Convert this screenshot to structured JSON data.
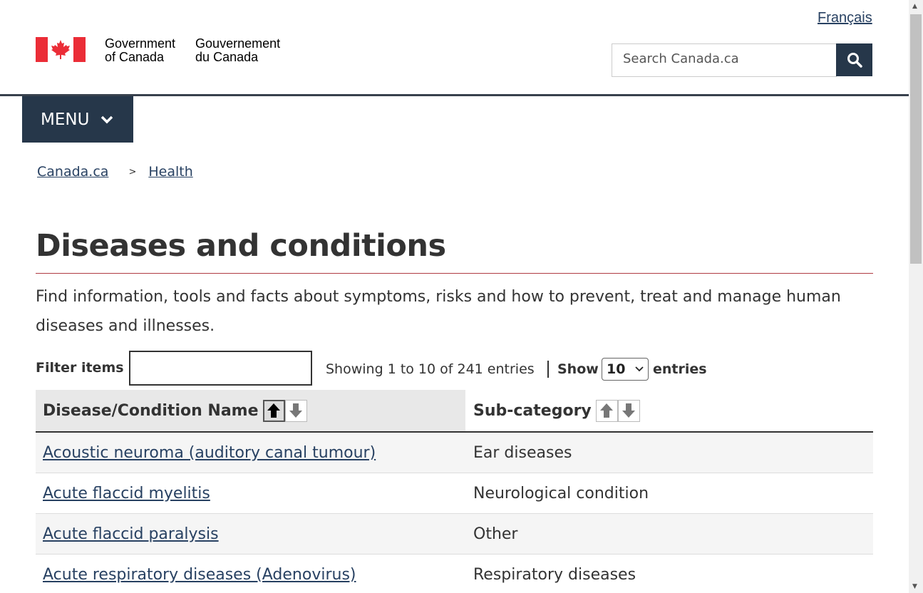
{
  "header": {
    "language_link": "Français",
    "logo_en": [
      "Government",
      "of Canada"
    ],
    "logo_fr": [
      "Gouvernement",
      "du Canada"
    ],
    "search_placeholder": "Search Canada.ca",
    "menu_label": "MENU",
    "flag_color": "#eb2d37",
    "nav_color": "#26374a"
  },
  "breadcrumb": {
    "items": [
      "Canada.ca",
      "Health"
    ],
    "separator": ">"
  },
  "main": {
    "title": "Diseases and conditions",
    "intro": "Find information, tools and facts about symptoms, risks and how to prevent, treat and manage human diseases and illnesses."
  },
  "controls": {
    "filter_label": "Filter items",
    "filter_value": "",
    "showing_text": "Showing 1 to 10 of 241 entries",
    "show_label": "Show",
    "show_value": "10",
    "entries_label": "entries"
  },
  "table": {
    "columns": [
      "Disease/Condition Name",
      "Sub-category"
    ],
    "rows": [
      {
        "name": "Acoustic neuroma (auditory canal tumour)",
        "category": "Ear diseases"
      },
      {
        "name": "Acute flaccid myelitis",
        "category": "Neurological condition"
      },
      {
        "name": "Acute flaccid paralysis",
        "category": "Other"
      },
      {
        "name": "Acute respiratory diseases (Adenovirus)",
        "category": "Respiratory diseases"
      }
    ]
  },
  "icons": {
    "search": "search-icon",
    "menu_chevron": "chevron-down-icon",
    "sort_asc": "arrow-up-icon",
    "sort_desc": "arrow-down-icon"
  }
}
